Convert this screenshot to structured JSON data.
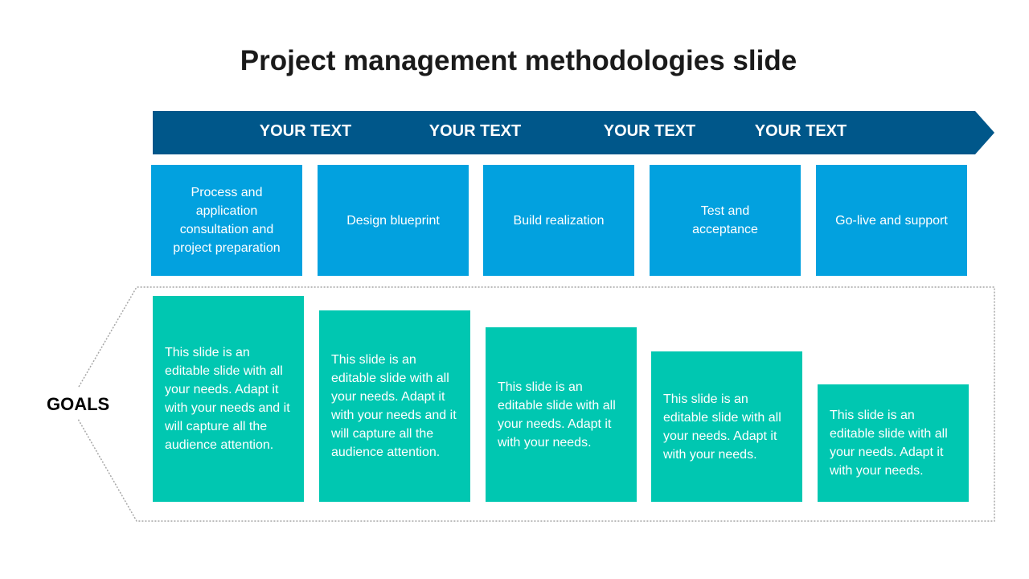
{
  "title": "Project management methodologies slide",
  "header_labels": [
    "YOUR TEXT",
    "YOUR TEXT",
    "YOUR TEXT",
    "YOUR TEXT"
  ],
  "phases": [
    "Process and application consultation and project preparation",
    "Design blueprint",
    "Build realization",
    "Test and acceptance",
    "Go-live and support"
  ],
  "goals_label": "GOALS",
  "goals": [
    "This slide is an editable slide with all your needs. Adapt it with your needs and it will capture all the audience attention.",
    "This slide is an editable slide with all your needs. Adapt it with your needs and it will capture all the audience attention.",
    "This slide is an editable slide with all your needs. Adapt it with your needs.",
    "This slide is an editable slide with all your needs. Adapt it with your needs.",
    "This slide is an editable slide with all your needs. Adapt it with your needs."
  ],
  "colors": {
    "arrow": "#00578A",
    "phase": "#02A1DF",
    "goal": "#00C7B1"
  }
}
